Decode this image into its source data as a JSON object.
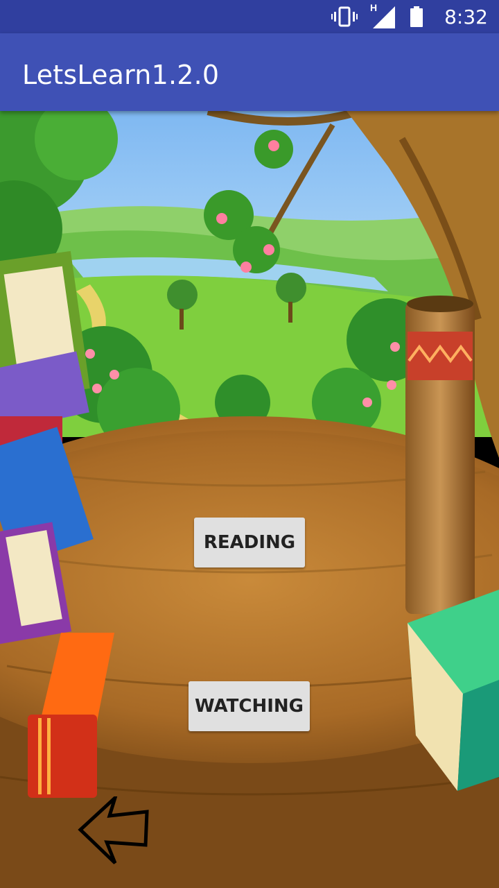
{
  "status_bar": {
    "time": "8:32",
    "network_label": "H",
    "icons": [
      "vibrate-icon",
      "signal-icon",
      "battery-icon"
    ]
  },
  "app_bar": {
    "title": "LetsLearn1.2.0",
    "color": "#3f51b5"
  },
  "buttons": {
    "reading": "READING",
    "watching": "WATCHING"
  },
  "back": {
    "icon": "back-arrow-icon"
  }
}
